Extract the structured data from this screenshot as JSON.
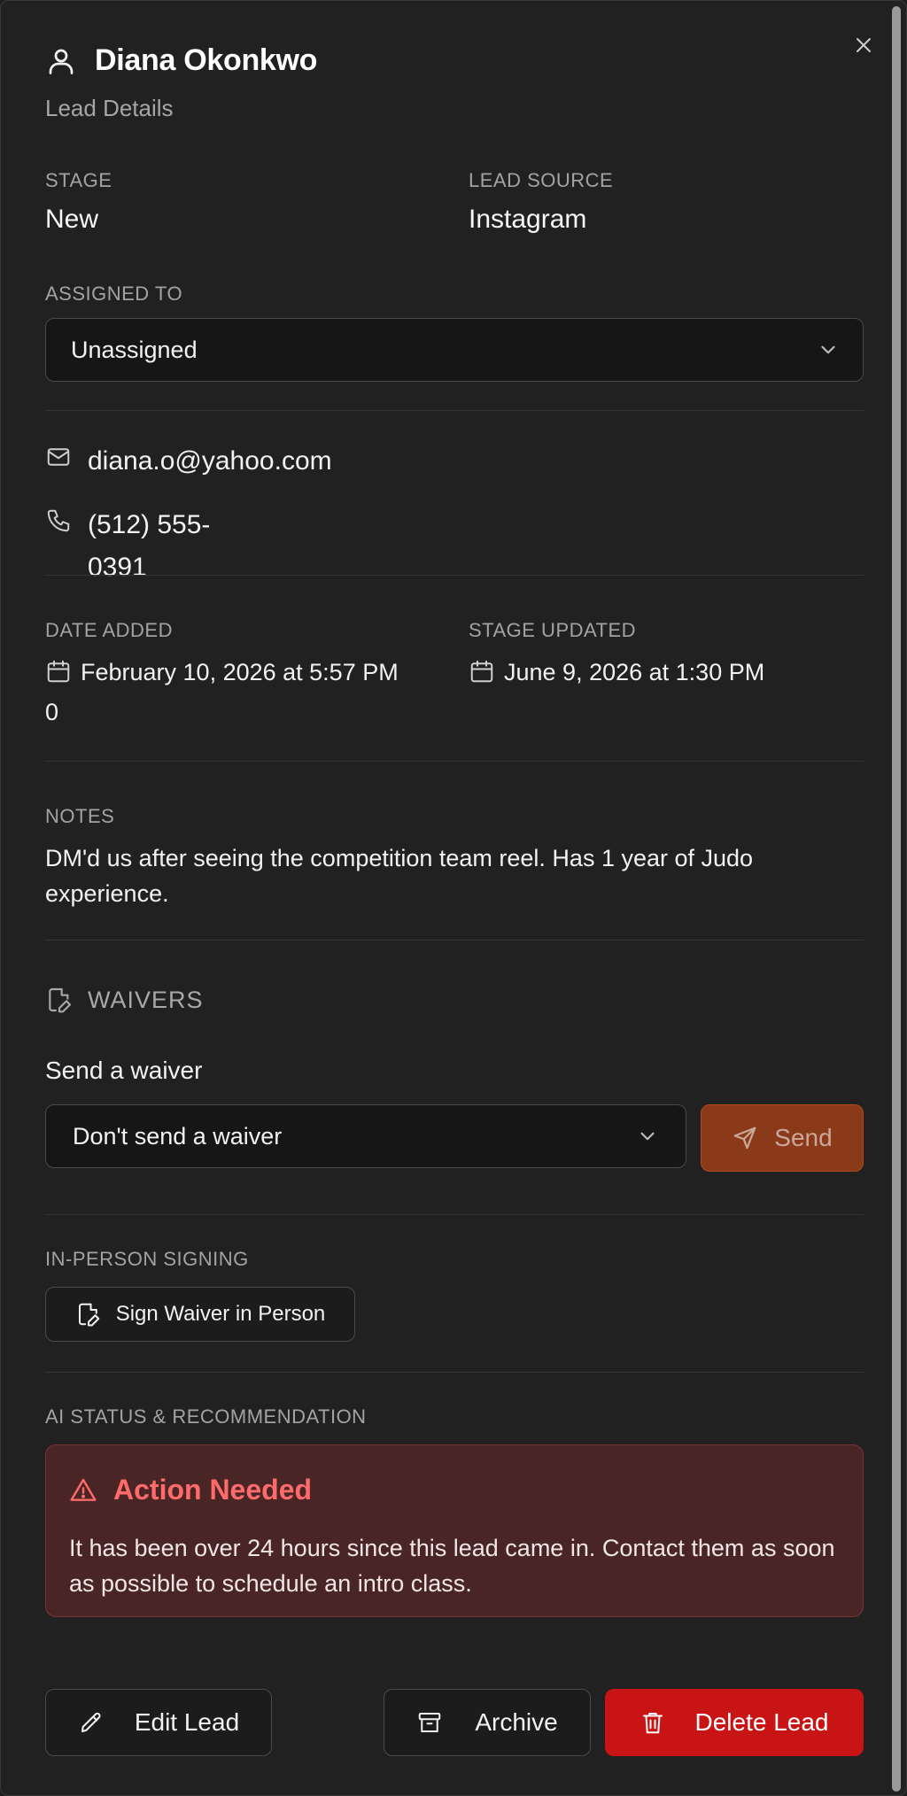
{
  "header": {
    "title": "Diana Okonkwo",
    "subtitle": "Lead Details",
    "close_icon": "close-icon"
  },
  "stage": {
    "label": "STAGE",
    "value": "New"
  },
  "lead_source": {
    "label": "LEAD SOURCE",
    "value": "Instagram"
  },
  "assigned_to": {
    "label": "ASSIGNED TO",
    "selected": "Unassigned"
  },
  "contact": {
    "email": "diana.o@yahoo.com",
    "phone_line1": "(512) 555-",
    "phone_line2": "0391"
  },
  "date_added": {
    "label": "DATE ADDED",
    "value_line1": "February 10, 2026 at 5:57 PM",
    "value_line2": "0"
  },
  "stage_updated": {
    "label": "STAGE UPDATED",
    "value": "June 9, 2026 at 1:30 PM"
  },
  "notes": {
    "label": "NOTES",
    "text": "DM'd us after seeing the competition team reel. Has 1 year of Judo experience."
  },
  "waivers": {
    "heading": "WAIVERS",
    "send_label": "Send a waiver",
    "selected": "Don't send a waiver",
    "send_button": "Send"
  },
  "in_person": {
    "label": "IN-PERSON SIGNING",
    "button": "Sign Waiver in Person"
  },
  "ai_status": {
    "label": "AI STATUS & RECOMMENDATION",
    "alert_title": "Action Needed",
    "alert_body": "It has been over 24 hours since this lead came in. Contact them as soon as possible to schedule an intro class."
  },
  "actions": {
    "edit": "Edit Lead",
    "archive": "Archive",
    "delete": "Delete Lead"
  },
  "colors": {
    "background": "#212121",
    "send_button": "#8a3a18",
    "alert_bg": "#4a2526",
    "alert_title": "#ff6b6b",
    "delete_button": "#c81414"
  }
}
